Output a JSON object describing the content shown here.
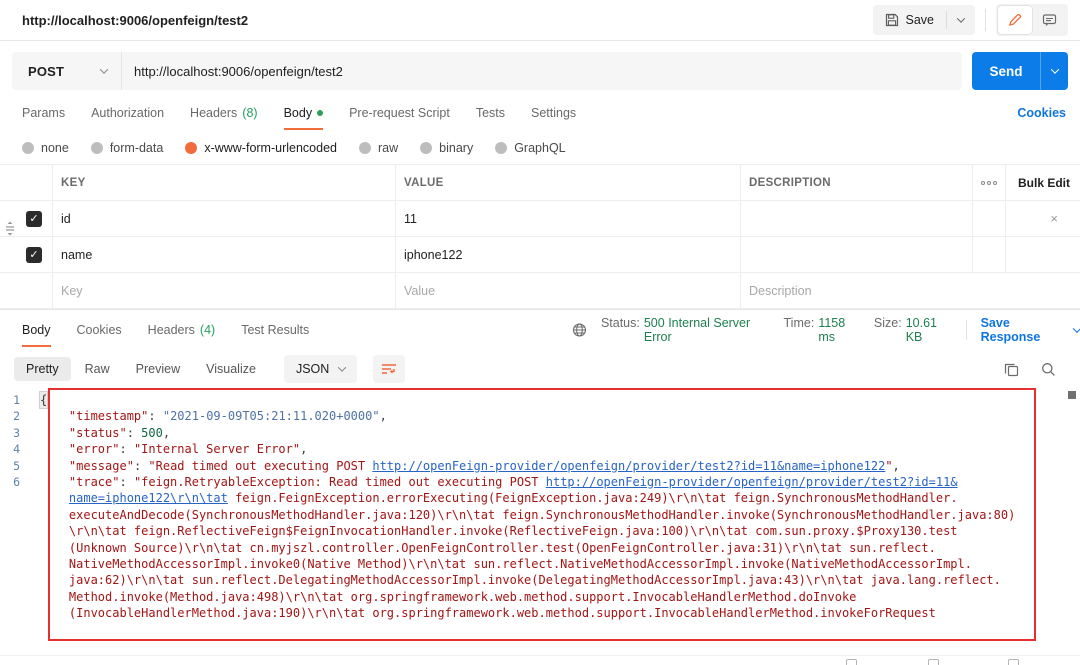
{
  "workspace": {
    "tab_title": "http://localhost:9006/openfeign/test2",
    "save_label": "Save"
  },
  "request": {
    "method": "POST",
    "url": "http://localhost:9006/openfeign/test2",
    "send_label": "Send",
    "tabs": [
      {
        "label": "Params"
      },
      {
        "label": "Authorization"
      },
      {
        "label": "Headers",
        "count": "(8)"
      },
      {
        "label": "Body",
        "active": true,
        "has_green_dot": true
      },
      {
        "label": "Pre-request Script"
      },
      {
        "label": "Tests"
      },
      {
        "label": "Settings"
      }
    ],
    "cookies_link": "Cookies",
    "body_modes": [
      {
        "label": "none"
      },
      {
        "label": "form-data"
      },
      {
        "label": "x-www-form-urlencoded",
        "selected": true
      },
      {
        "label": "raw"
      },
      {
        "label": "binary"
      },
      {
        "label": "GraphQL"
      }
    ],
    "table": {
      "headers": {
        "key": "KEY",
        "value": "VALUE",
        "description": "DESCRIPTION"
      },
      "bulk_edit_label": "Bulk Edit",
      "rows": [
        {
          "key": "id",
          "value": "11",
          "description": "",
          "checked": true
        },
        {
          "key": "name",
          "value": "iphone122",
          "description": "",
          "checked": true
        }
      ],
      "placeholders": {
        "key": "Key",
        "value": "Value",
        "description": "Description"
      }
    }
  },
  "response": {
    "tabs": [
      {
        "label": "Body",
        "active": true
      },
      {
        "label": "Cookies"
      },
      {
        "label": "Headers",
        "count": "(4)"
      },
      {
        "label": "Test Results"
      }
    ],
    "meta": {
      "status_label": "Status:",
      "status_value": "500 Internal Server Error",
      "time_label": "Time:",
      "time_value": "1158 ms",
      "size_label": "Size:",
      "size_value": "10.61 KB",
      "save_response_label": "Save Response"
    },
    "view_tabs": [
      {
        "label": "Pretty",
        "selected": true
      },
      {
        "label": "Raw"
      },
      {
        "label": "Preview"
      },
      {
        "label": "Visualize"
      }
    ],
    "format": "JSON",
    "code_rows": [
      {
        "n": "1",
        "seg": [
          {
            "t": "{",
            "c": "brace"
          }
        ]
      },
      {
        "n": "2",
        "seg": [
          {
            "t": "    ",
            "c": "p"
          },
          {
            "t": "\"timestamp\"",
            "c": "k"
          },
          {
            "t": ": ",
            "c": "p"
          },
          {
            "t": "\"2021-09-09T05:21:11.020+0000\"",
            "c": "sv"
          },
          {
            "t": ",",
            "c": "p"
          }
        ]
      },
      {
        "n": "3",
        "seg": [
          {
            "t": "    ",
            "c": "p"
          },
          {
            "t": "\"status\"",
            "c": "k"
          },
          {
            "t": ": ",
            "c": "p"
          },
          {
            "t": "500",
            "c": "n"
          },
          {
            "t": ",",
            "c": "p"
          }
        ]
      },
      {
        "n": "4",
        "seg": [
          {
            "t": "    ",
            "c": "p"
          },
          {
            "t": "\"error\"",
            "c": "k"
          },
          {
            "t": ": ",
            "c": "p"
          },
          {
            "t": "\"Internal Server Error\"",
            "c": "s"
          },
          {
            "t": ",",
            "c": "p"
          }
        ]
      },
      {
        "n": "5",
        "seg": [
          {
            "t": "    ",
            "c": "p"
          },
          {
            "t": "\"message\"",
            "c": "k"
          },
          {
            "t": ": ",
            "c": "p"
          },
          {
            "t": "\"Read timed out executing POST ",
            "c": "s"
          },
          {
            "t": "http://openFeign-provider/openfeign/provider/test2?id=11&name=iphone122",
            "c": "a"
          },
          {
            "t": "\"",
            "c": "s"
          },
          {
            "t": ",",
            "c": "p"
          }
        ]
      },
      {
        "n": "6",
        "seg": [
          {
            "t": "    ",
            "c": "p"
          },
          {
            "t": "\"trace\"",
            "c": "k"
          },
          {
            "t": ": ",
            "c": "p"
          },
          {
            "t": "\"feign.RetryableException: Read timed out executing POST ",
            "c": "s"
          },
          {
            "t": "http://openFeign-provider/openfeign/provider/test2?id=11&",
            "c": "a"
          }
        ]
      },
      {
        "n": "",
        "seg": [
          {
            "t": "    ",
            "c": "p"
          },
          {
            "t": "name=iphone122\\r\\n\\tat",
            "c": "a"
          },
          {
            "t": " feign.FeignException.errorExecuting(FeignException.java:249)\\r\\n\\tat feign.SynchronousMethodHandler.",
            "c": "s"
          }
        ]
      },
      {
        "n": "",
        "seg": [
          {
            "t": "    ",
            "c": "p"
          },
          {
            "t": "executeAndDecode(SynchronousMethodHandler.java:120)\\r\\n\\tat feign.SynchronousMethodHandler.invoke(SynchronousMethodHandler.java:80)",
            "c": "s"
          }
        ]
      },
      {
        "n": "",
        "seg": [
          {
            "t": "    ",
            "c": "p"
          },
          {
            "t": "\\r\\n\\tat feign.ReflectiveFeign$FeignInvocationHandler.invoke(ReflectiveFeign.java:100)\\r\\n\\tat com.sun.proxy.$Proxy130.test",
            "c": "s"
          }
        ]
      },
      {
        "n": "",
        "seg": [
          {
            "t": "    ",
            "c": "p"
          },
          {
            "t": "(Unknown Source)\\r\\n\\tat cn.myjszl.controller.OpenFeignController.test(OpenFeignController.java:31)\\r\\n\\tat sun.reflect.",
            "c": "s"
          }
        ]
      },
      {
        "n": "",
        "seg": [
          {
            "t": "    ",
            "c": "p"
          },
          {
            "t": "NativeMethodAccessorImpl.invoke0(Native Method)\\r\\n\\tat sun.reflect.NativeMethodAccessorImpl.invoke(NativeMethodAccessorImpl.",
            "c": "s"
          }
        ]
      },
      {
        "n": "",
        "seg": [
          {
            "t": "    ",
            "c": "p"
          },
          {
            "t": "java:62)\\r\\n\\tat sun.reflect.DelegatingMethodAccessorImpl.invoke(DelegatingMethodAccessorImpl.java:43)\\r\\n\\tat java.lang.reflect.",
            "c": "s"
          }
        ]
      },
      {
        "n": "",
        "seg": [
          {
            "t": "    ",
            "c": "p"
          },
          {
            "t": "Method.invoke(Method.java:498)\\r\\n\\tat org.springframework.web.method.support.InvocableHandlerMethod.doInvoke",
            "c": "s"
          }
        ]
      },
      {
        "n": "",
        "seg": [
          {
            "t": "    ",
            "c": "p"
          },
          {
            "t": "(InvocableHandlerMethod.java:190)\\r\\n\\tat org.springframework.web.method.support.InvocableHandlerMethod.invokeForRequest",
            "c": "s"
          }
        ]
      }
    ]
  },
  "colors": {
    "accent": "#f26b3a",
    "blue": "#0e76de",
    "send-blue": "#0b7ce8",
    "green-count": "#24a05e",
    "green-status": "#1e7f4f",
    "code-key": "#a31515",
    "code-str": "#a31515",
    "code-strblue": "#4e71a5",
    "code-num": "#116644",
    "code-link": "#2764c6",
    "ln": "#5e81a8",
    "annot": "#e53030"
  }
}
